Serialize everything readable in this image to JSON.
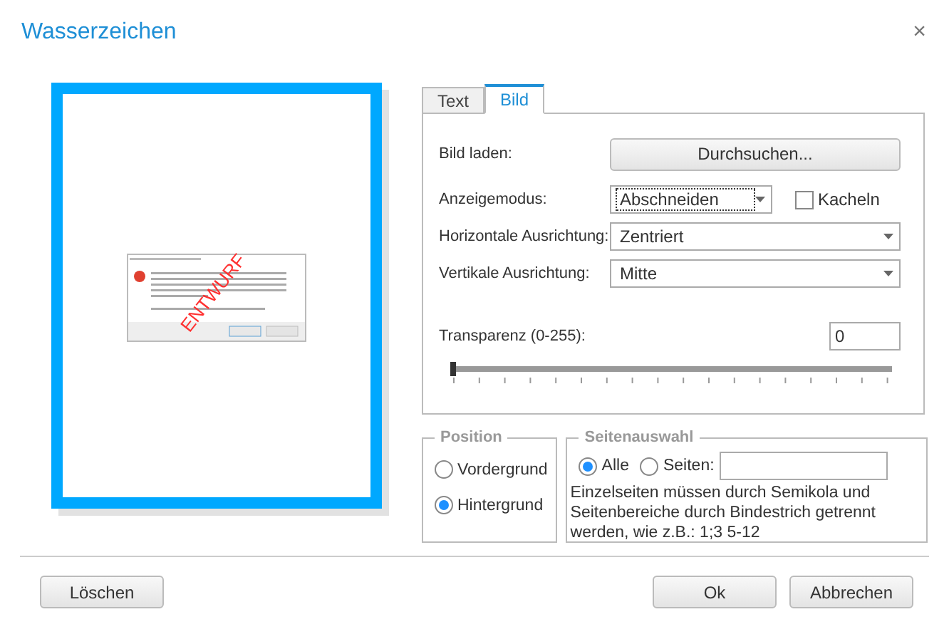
{
  "window": {
    "title": "Wasserzeichen",
    "close": "×"
  },
  "preview": {
    "watermark": "ENTWURF"
  },
  "tabs": [
    {
      "label": "Text",
      "selected": false
    },
    {
      "label": "Bild",
      "selected": true
    }
  ],
  "image": {
    "load_label": "Bild laden:",
    "browse_button": "Durchsuchen...",
    "display_mode_label": "Anzeigemodus:",
    "display_mode": "Abschneiden",
    "tile": {
      "label": "Kacheln",
      "checked": false
    },
    "horizontal_label": "Horizontale Ausrichtung:",
    "horizontal": "Zentriert",
    "vertical_label": "Vertikale Ausrichtung:",
    "vertical": "Mitte",
    "transparency_label": "Transparenz (0-255):",
    "transparency": "0",
    "level": 0
  },
  "position": {
    "title": "Position",
    "options": [
      {
        "label": "Vordergrund",
        "selected": false
      },
      {
        "label": "Hintergrund",
        "selected": true
      }
    ]
  },
  "pages": {
    "title": "Seitenauswahl",
    "options": [
      {
        "label": "Alle",
        "selected": true
      },
      {
        "label": "Seiten:",
        "selected": false
      }
    ],
    "hint": "Einzelseiten müssen durch Semikola und Seitenbereiche durch Bindestrich getrennt werden, wie z.B.: 1;3 5-12"
  },
  "buttons": {
    "clear": "Löschen",
    "ok": "Ok",
    "cancel": "Abbrechen"
  }
}
